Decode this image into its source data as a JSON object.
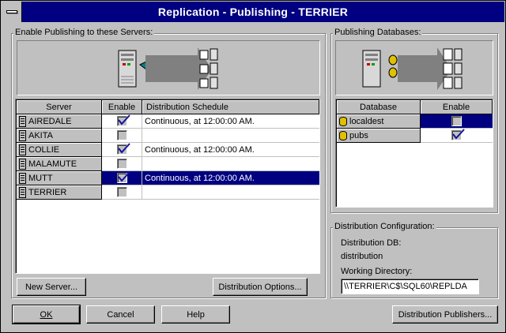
{
  "window": {
    "title": "Replication - Publishing - TERRIER"
  },
  "servers_group": {
    "label": "Enable Publishing to these Servers:",
    "columns": [
      "Server",
      "Enable",
      "Distribution Schedule"
    ],
    "rows": [
      {
        "name": "AIREDALE",
        "enabled": true,
        "schedule": "Continuous, at 12:00:00 AM.",
        "selected": false
      },
      {
        "name": "AKITA",
        "enabled": false,
        "schedule": "",
        "selected": false
      },
      {
        "name": "COLLIE",
        "enabled": true,
        "schedule": "Continuous, at 12:00:00 AM.",
        "selected": false
      },
      {
        "name": "MALAMUTE",
        "enabled": false,
        "schedule": "",
        "selected": false
      },
      {
        "name": "MUTT",
        "enabled": true,
        "schedule": "Continuous, at 12:00:00 AM.",
        "selected": true
      },
      {
        "name": "TERRIER",
        "enabled": false,
        "schedule": "",
        "selected": false
      }
    ],
    "new_server_button": "New Server...",
    "distribution_options_button": "Distribution Options..."
  },
  "databases_group": {
    "label": "Publishing Databases:",
    "columns": [
      "Database",
      "Enable"
    ],
    "rows": [
      {
        "name": "localdest",
        "enabled": false,
        "selected": true
      },
      {
        "name": "pubs",
        "enabled": true,
        "selected": false
      }
    ]
  },
  "distribution_config": {
    "label": "Distribution Configuration:",
    "db_label": "Distribution DB:",
    "db_value": "distribution",
    "working_dir_label": "Working Directory:",
    "working_dir_value": "\\\\TERRIER\\C$\\SQL60\\REPLDA"
  },
  "buttons": {
    "ok": "OK",
    "cancel": "Cancel",
    "help": "Help",
    "distribution_publishers": "Distribution Publishers..."
  },
  "colors": {
    "title_bar": "#000080",
    "face": "#c0c0c0",
    "selection": "#000080"
  }
}
